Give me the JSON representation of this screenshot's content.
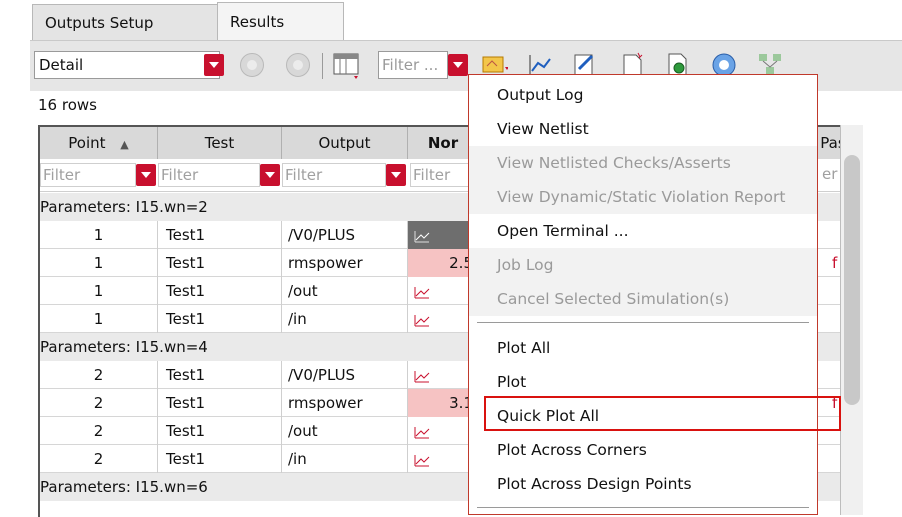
{
  "tabs": [
    {
      "label": "Outputs Setup"
    },
    {
      "label": "Results"
    }
  ],
  "toolbar": {
    "detail_value": "Detail",
    "filter_placeholder": "Filter ..."
  },
  "rows_count": "16 rows",
  "table": {
    "headers": [
      "Point",
      "Test",
      "Output",
      "Nor",
      "Pas"
    ],
    "filter_placeholder": "Filter",
    "groups": [
      {
        "label": "Parameters: I15.wn=2",
        "rows": [
          {
            "point": "1",
            "test": "Test1",
            "output": "/V0/PLUS",
            "nominal": ""
          },
          {
            "point": "1",
            "test": "Test1",
            "output": "rmspower",
            "nominal": "2.5"
          },
          {
            "point": "1",
            "test": "Test1",
            "output": "/out",
            "nominal": ""
          },
          {
            "point": "1",
            "test": "Test1",
            "output": "/in",
            "nominal": ""
          }
        ]
      },
      {
        "label": "Parameters: I15.wn=4",
        "rows": [
          {
            "point": "2",
            "test": "Test1",
            "output": "/V0/PLUS",
            "nominal": ""
          },
          {
            "point": "2",
            "test": "Test1",
            "output": "rmspower",
            "nominal": "3.1"
          },
          {
            "point": "2",
            "test": "Test1",
            "output": "/out",
            "nominal": ""
          },
          {
            "point": "2",
            "test": "Test1",
            "output": "/in",
            "nominal": ""
          }
        ]
      },
      {
        "label": "Parameters: I15.wn=6",
        "rows": []
      }
    ],
    "pass_fragment": "f",
    "filter_fragment": "er"
  },
  "context_menu": {
    "items": [
      {
        "label": "Output Log"
      },
      {
        "label": "View Netlist"
      },
      {
        "label": "View Netlisted Checks/Asserts"
      },
      {
        "label": "View Dynamic/Static Violation Report"
      },
      {
        "label": "Open Terminal ..."
      },
      {
        "label": "Job Log"
      },
      {
        "label": "Cancel Selected Simulation(s)"
      },
      {
        "label": "Plot All"
      },
      {
        "label": "Plot"
      },
      {
        "label": "Quick Plot All"
      },
      {
        "label": "Plot Across Corners"
      },
      {
        "label": "Plot Across Design Points"
      }
    ]
  },
  "colors": {
    "accent_red": "#c8102e",
    "highlight_box": "#d9120f",
    "fail_cell": "#f6c3c3"
  }
}
